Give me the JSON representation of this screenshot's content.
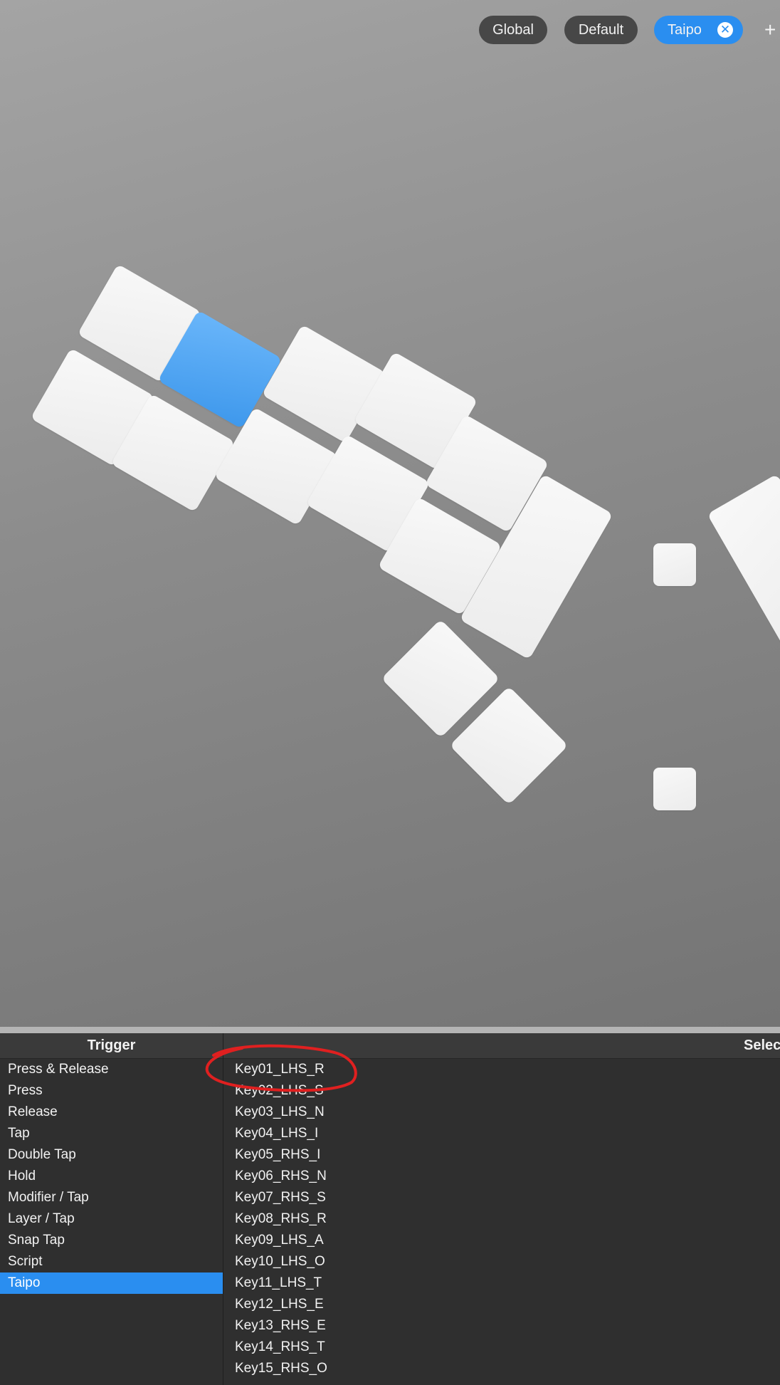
{
  "layer_tabs": [
    {
      "label": "Global"
    },
    {
      "label": "Default"
    },
    {
      "label": "Taipo",
      "active": true
    }
  ],
  "close_glyph": "✕",
  "add_layer_glyph": "+",
  "keyboard": {
    "selected_key_color": "#3e98ec",
    "key_color": "#f2f2f2"
  },
  "panel": {
    "trigger_header": "Trigger",
    "select_header": "Select"
  },
  "triggers": [
    {
      "label": "Press & Release"
    },
    {
      "label": "Press"
    },
    {
      "label": "Release"
    },
    {
      "label": "Tap"
    },
    {
      "label": "Double Tap"
    },
    {
      "label": "Hold"
    },
    {
      "label": "Modifier / Tap"
    },
    {
      "label": "Layer / Tap"
    },
    {
      "label": "Snap Tap"
    },
    {
      "label": "Script"
    },
    {
      "label": "Taipo",
      "active": true
    }
  ],
  "keys": [
    {
      "label": "Key01_LHS_R"
    },
    {
      "label": "Key02_LHS_S"
    },
    {
      "label": "Key03_LHS_N"
    },
    {
      "label": "Key04_LHS_I"
    },
    {
      "label": "Key05_RHS_I"
    },
    {
      "label": "Key06_RHS_N"
    },
    {
      "label": "Key07_RHS_S"
    },
    {
      "label": "Key08_RHS_R"
    },
    {
      "label": "Key09_LHS_A"
    },
    {
      "label": "Key10_LHS_O"
    },
    {
      "label": "Key11_LHS_T"
    },
    {
      "label": "Key12_LHS_E"
    },
    {
      "label": "Key13_RHS_E"
    },
    {
      "label": "Key14_RHS_T"
    },
    {
      "label": "Key15_RHS_O"
    }
  ],
  "annotation_color": "#e02020"
}
